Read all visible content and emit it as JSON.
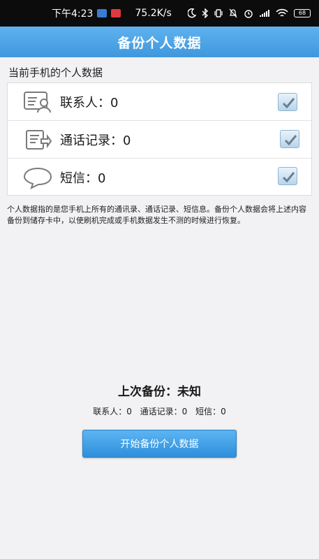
{
  "status_bar": {
    "time": "下午4:23",
    "speed": "75.2K/s",
    "battery": "68"
  },
  "header": {
    "title": "备份个人数据"
  },
  "section_title": "当前手机的个人数据",
  "items": [
    {
      "label": "联系人：0",
      "icon": "contact-card-icon",
      "checked": true
    },
    {
      "label": "通话记录：0",
      "icon": "call-log-icon",
      "checked": true
    },
    {
      "label": "短信：0",
      "icon": "speech-bubble-icon",
      "checked": true
    }
  ],
  "description": "个人数据指的是您手机上所有的通讯录、通话记录、短信息。备份个人数据会将上述内容备份到储存卡中，以使刷机完成或手机数据发生不测的时候进行恢复。",
  "last_backup": {
    "title": "上次备份：未知",
    "contacts": "联系人：0",
    "calls": "通话记录：0",
    "sms": "短信：0"
  },
  "start_button": "开始备份个人数据",
  "colors": {
    "title_bar": "#4aa3e6",
    "button": "#3f9de4",
    "background": "#f2f1f3"
  }
}
